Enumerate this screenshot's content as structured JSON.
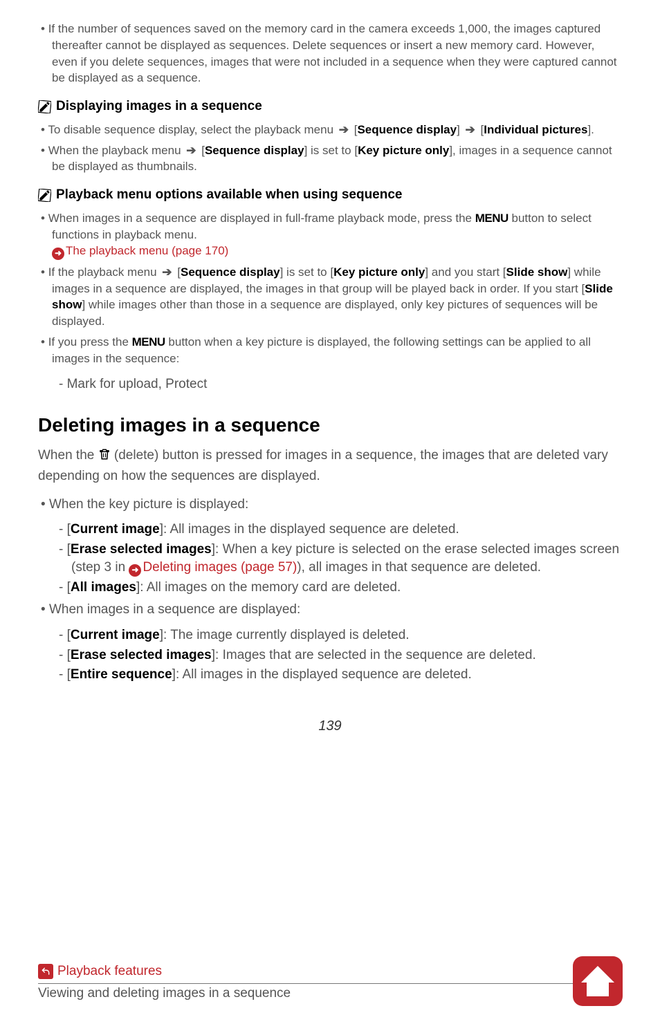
{
  "top_bullet": "If the number of sequences saved on the memory card in the camera exceeds 1,000, the images captured thereafter cannot be displayed as sequences. Delete sequences or insert a new memory card. However, even if you delete sequences, images that were not included in a sequence when they were captured cannot be displayed as a sequence.",
  "note1_title": "Displaying images in a sequence",
  "note1_items": {
    "a": {
      "pre": "To disable sequence display, select the playback menu ",
      "seq": "Sequence display",
      "post_seq": " [",
      "ind": "Individual pictures",
      "tail": "]."
    },
    "b": {
      "pre": "When the playback menu ",
      "seq": "Sequence display",
      "mid": "] is set to [",
      "key": "Key picture only",
      "tail": "], images in a sequence cannot be displayed as thumbnails."
    }
  },
  "note2_title": "Playback menu options available when using sequence",
  "note2_items": {
    "a": {
      "pre": "When images in a sequence are displayed in full-frame playback mode, press the ",
      "menu": "MENU",
      "mid": " button to select functions in playback menu.",
      "link": "The playback menu (page 170)"
    },
    "b": {
      "pre": "If the playback menu ",
      "seq": "Sequence display",
      "mid1": "] is set to [",
      "key": "Key picture only",
      "mid2": "] and you start [",
      "slide": "Slide show",
      "mid3": "] while images in a sequence are displayed, the images in that group will be played back in order. If you start [",
      "slide2": "Slide show",
      "tail": "] while images other than those in a sequence are displayed, only key pictures of sequences will be displayed."
    },
    "c": {
      "pre": "If you press the ",
      "menu": "MENU",
      "tail": " button when a key picture is displayed, the following settings can be applied to all images in the sequence:"
    },
    "c_sub": "Mark for upload, Protect"
  },
  "heading2": "Deleting images in a sequence",
  "del_para": {
    "pre": "When the ",
    "mid": " (delete) button is pressed for images in a sequence, the images that are deleted vary depending on how the sequences are displayed."
  },
  "list1_head": "When the key picture is displayed:",
  "list1": {
    "a": {
      "label": "Current image",
      "tail": "]: All images in the displayed sequence are deleted."
    },
    "b": {
      "label": "Erase selected images",
      "tail": "]: When a key picture is selected on the erase selected images screen (step 3 in ",
      "link": "Deleting images (page 57)",
      "tail2": "), all images in that sequence are deleted."
    },
    "c": {
      "label": "All images",
      "tail": "]: All images on the memory card are deleted."
    }
  },
  "list2_head": "When images in a sequence are displayed:",
  "list2": {
    "a": {
      "label": "Current image",
      "tail": "]: The image currently displayed is deleted."
    },
    "b": {
      "label": "Erase selected images",
      "tail": "]: Images that are selected in the sequence are deleted."
    },
    "c": {
      "label": "Entire sequence",
      "tail": "]: All images in the displayed sequence are deleted."
    }
  },
  "page_number": "139",
  "crumb1": "Playback features",
  "crumb2": "Viewing and deleting images in a sequence"
}
